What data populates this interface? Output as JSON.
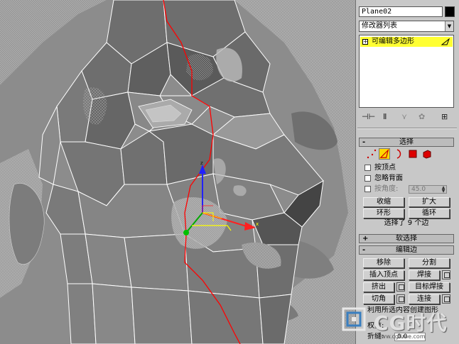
{
  "object": {
    "name": "Plane02",
    "color": "#000000"
  },
  "modifier_list": {
    "label": "修改器列表"
  },
  "stack": {
    "item": "可编辑多边形",
    "toggle": "+"
  },
  "stack_tools": {
    "pin": "⊣⊢",
    "show": "Ⅱ",
    "unique": "⋎",
    "remove": "✿",
    "config": "⊞"
  },
  "selection": {
    "title": "选择",
    "sign": "-",
    "by_vertex": "按顶点",
    "ignore_backfacing": "忽略背面",
    "by_angle": "按角度:",
    "angle_value": "45.0",
    "shrink": "收缩",
    "grow": "扩大",
    "ring": "环形",
    "loop": "循环",
    "status": "选择了 9 个边"
  },
  "soft_selection": {
    "title": "软选择",
    "sign": "+"
  },
  "edit_edges": {
    "title": "编辑边",
    "sign": "-",
    "remove": "移除",
    "split": "分割",
    "insert_vertex": "插入顶点",
    "weld": "焊接",
    "extrude": "挤出",
    "target_weld": "目标焊接",
    "chamfer": "切角",
    "connect": "连接",
    "create_shape": "利用所选内容创建图形",
    "weight": "权重:",
    "crease": "折缝:",
    "crease_value": "0.0"
  },
  "watermark": {
    "text": "CG时代",
    "url": "www.cgtime.com"
  },
  "colors": {
    "panel": "#c8c8c8",
    "highlight": "#ffff33",
    "active_icon": "#ffd800",
    "edge_sel": "#ff0000",
    "wire": "#ffffff"
  }
}
